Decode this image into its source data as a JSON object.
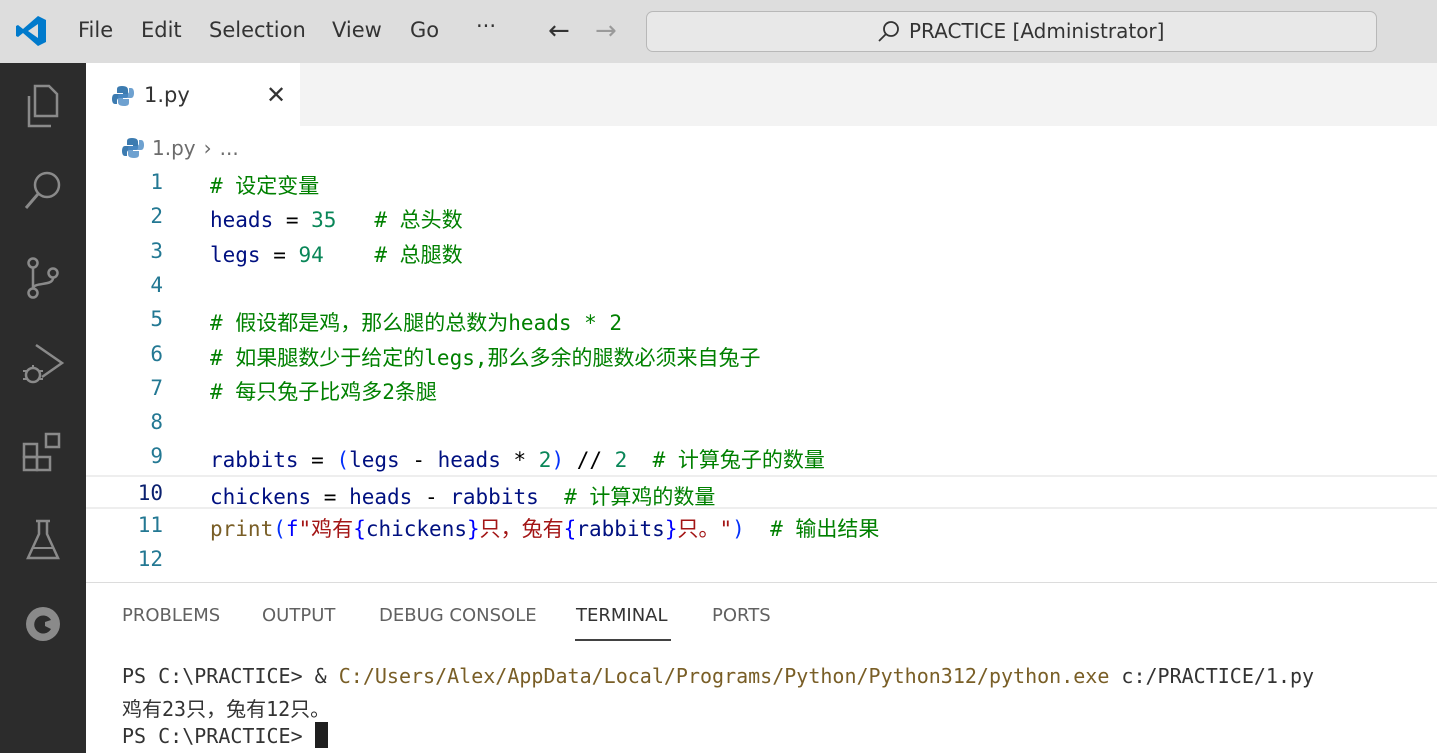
{
  "titlebar": {
    "menu": [
      "File",
      "Edit",
      "Selection",
      "View",
      "Go",
      "···"
    ],
    "search_text": "PRACTICE [Administrator]"
  },
  "colors": {
    "accent": "#007acc",
    "activitybar_bg": "#2c2c2c",
    "titlebar_bg": "#dddddd",
    "comment": "#008000",
    "number": "#098658",
    "variable": "#001080",
    "function": "#795e26",
    "string": "#a31515"
  },
  "activitybar": {
    "icons": [
      "explorer-icon",
      "search-icon",
      "source-control-icon",
      "run-debug-icon",
      "extensions-icon",
      "testing-icon",
      "remote-icon"
    ]
  },
  "tab": {
    "label": "1.py",
    "close": "✕"
  },
  "breadcrumb": {
    "file": "1.py",
    "separator": "›",
    "rest": "..."
  },
  "editor": {
    "active_line": 10,
    "lines": [
      {
        "n": "1",
        "segments": [
          [
            "cm",
            "# 设定变量"
          ]
        ]
      },
      {
        "n": "2",
        "segments": [
          [
            "var",
            "heads"
          ],
          [
            "op",
            " = "
          ],
          [
            "num",
            "35"
          ],
          [
            "op",
            "   "
          ],
          [
            "cm",
            "# 总头数"
          ]
        ]
      },
      {
        "n": "3",
        "segments": [
          [
            "var",
            "legs"
          ],
          [
            "op",
            " = "
          ],
          [
            "num",
            "94"
          ],
          [
            "op",
            "    "
          ],
          [
            "cm",
            "# 总腿数"
          ]
        ]
      },
      {
        "n": "4",
        "segments": []
      },
      {
        "n": "5",
        "segments": [
          [
            "cm",
            "# 假设都是鸡，那么腿的总数为heads * 2"
          ]
        ]
      },
      {
        "n": "6",
        "segments": [
          [
            "cm",
            "# 如果腿数少于给定的legs,那么多余的腿数必须来自兔子"
          ]
        ]
      },
      {
        "n": "7",
        "segments": [
          [
            "cm",
            "# 每只兔子比鸡多2条腿"
          ]
        ]
      },
      {
        "n": "8",
        "segments": []
      },
      {
        "n": "9",
        "segments": [
          [
            "var",
            "rabbits"
          ],
          [
            "op",
            " = "
          ],
          [
            "p1",
            "("
          ],
          [
            "var",
            "legs"
          ],
          [
            "op",
            " - "
          ],
          [
            "var",
            "heads"
          ],
          [
            "op",
            " * "
          ],
          [
            "num",
            "2"
          ],
          [
            "p1",
            ")"
          ],
          [
            "op",
            " // "
          ],
          [
            "num",
            "2"
          ],
          [
            "op",
            "  "
          ],
          [
            "cm",
            "# 计算兔子的数量"
          ]
        ]
      },
      {
        "n": "10",
        "segments": [
          [
            "var",
            "chickens"
          ],
          [
            "op",
            " = "
          ],
          [
            "var",
            "heads"
          ],
          [
            "op",
            " - "
          ],
          [
            "var",
            "rabbits"
          ],
          [
            "op",
            "  "
          ],
          [
            "cm",
            "# 计算鸡的数量"
          ]
        ]
      },
      {
        "n": "11",
        "segments": [
          [
            "fn",
            "print"
          ],
          [
            "p1",
            "("
          ],
          [
            "kw",
            "f"
          ],
          [
            "str",
            "\"鸡有"
          ],
          [
            "kw",
            "{"
          ],
          [
            "var",
            "chickens"
          ],
          [
            "kw",
            "}"
          ],
          [
            "str",
            "只，兔有"
          ],
          [
            "kw",
            "{"
          ],
          [
            "var",
            "rabbits"
          ],
          [
            "kw",
            "}"
          ],
          [
            "str",
            "只。\""
          ],
          [
            "p1",
            ")"
          ],
          [
            "op",
            "  "
          ],
          [
            "cm",
            "# 输出结果"
          ]
        ]
      },
      {
        "n": "12",
        "segments": []
      }
    ]
  },
  "panel": {
    "tabs": [
      "PROBLEMS",
      "OUTPUT",
      "DEBUG CONSOLE",
      "TERMINAL",
      "PORTS"
    ],
    "active_tab": "TERMINAL",
    "terminal": {
      "prompt": "PS C:\\PRACTICE> ",
      "cmd_amp": "& ",
      "cmd_exe": "C:/Users/Alex/AppData/Local/Programs/Python/Python312/python.exe",
      "cmd_arg": " c:/PRACTICE/1.py",
      "output": "鸡有23只，兔有12只。",
      "prompt2": "PS C:\\PRACTICE> "
    }
  }
}
